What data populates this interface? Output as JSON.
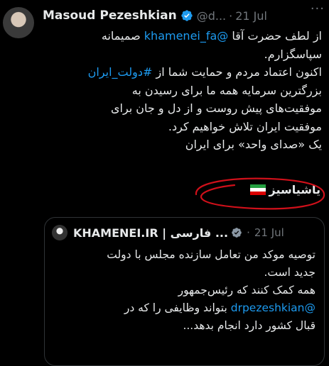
{
  "tweet": {
    "author_name": "Masoud Pezeshkian",
    "handle": "@d...",
    "separator": "·",
    "date": "21 Jul",
    "more": "···",
    "lines": [
      {
        "pre": "از لطف حضرت آقا ",
        "link": "@khamenei_fa",
        "post": " صمیمانه"
      },
      {
        "pre": "سپاسگزارم.",
        "link": "",
        "post": ""
      },
      {
        "pre": "اکنون اعتماد مردم و حمایت شما از ",
        "link": "#دولت_ایران",
        "post": ""
      },
      {
        "pre": "بزرگترین سرمایه همه ما برای رسیدن به",
        "link": "",
        "post": ""
      },
      {
        "pre": "موفقیت‌های پیش روست و از دل و جان برای",
        "link": "",
        "post": ""
      },
      {
        "pre": "موفقیت ایران تلاش خواهیم کرد.",
        "link": "",
        "post": ""
      },
      {
        "pre": "یک «صدای واحد» برای ایران",
        "link": "",
        "post": ""
      }
    ],
    "annotation": "یاشیاسیز"
  },
  "quote": {
    "author_name": "KHAMENEI.IR | فارسی ...",
    "separator": "·",
    "date": "21 Jul",
    "lines": [
      {
        "pre": "توصیه موکد من تعامل سازنده مجلس با دولت",
        "link": "",
        "post": ""
      },
      {
        "pre": "جدید است.",
        "link": "",
        "post": ""
      },
      {
        "pre": "همه کمک کنند که رئیس‌جمهور",
        "link": "",
        "post": ""
      },
      {
        "pre": "",
        "link": "@drpezeshkian",
        "post": " بتواند وظایفی را که در"
      },
      {
        "pre": "قبال کشور دارد انجام بدهد...",
        "link": "",
        "post": ""
      }
    ]
  },
  "colors": {
    "background": "#000000",
    "text": "#e7e9ea",
    "muted": "#71767b",
    "link": "#1d9bf0",
    "verified": "#1d9bf0",
    "scribble": "#d0101a"
  },
  "icons": {
    "verified": "verified-badge-icon",
    "flag": "iran-flag-icon",
    "more": "more-options-icon"
  }
}
